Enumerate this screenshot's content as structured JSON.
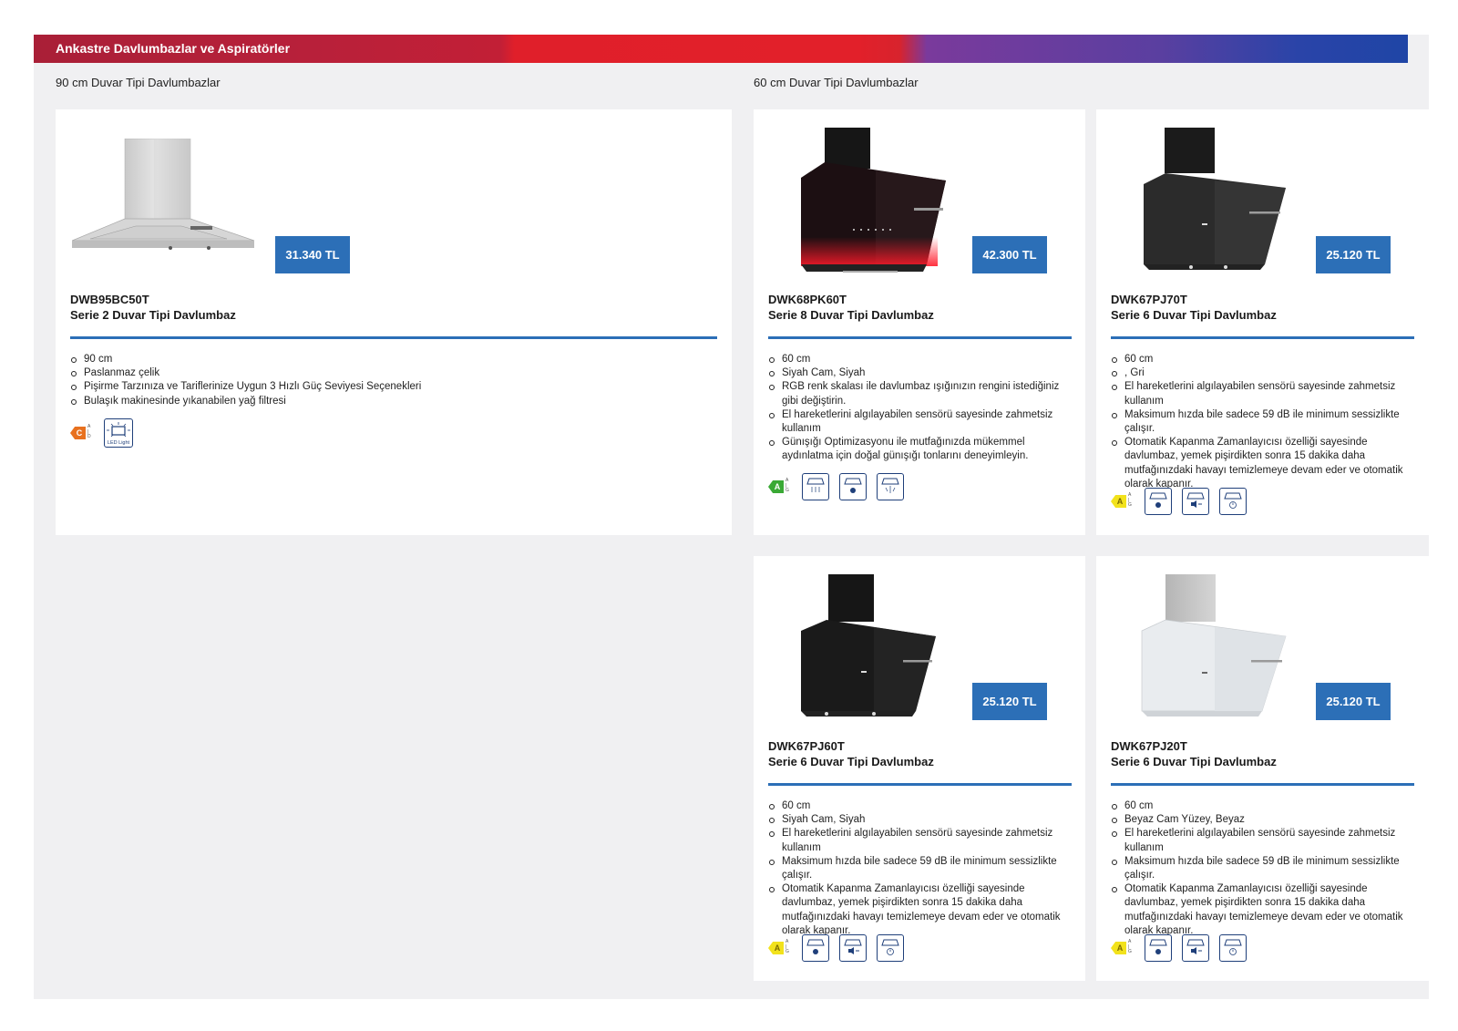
{
  "header": {
    "title": "Ankastre Davlumbazlar ve Aspiratörler"
  },
  "sections": {
    "left": {
      "title": "90 cm Duvar Tipi Davlumbazlar"
    },
    "right": {
      "title": "60 cm Duvar Tipi Davlumbazlar"
    }
  },
  "products": [
    {
      "model": "DWB95BC50T",
      "name": "Serie 2 Duvar Tipi Davlumbaz",
      "price": "31.340 TL",
      "energy_class": "C",
      "energy_color": "#e8711f",
      "features": [
        "90 cm",
        "Paslanmaz çelik",
        "Pişirme Tarzınıza ve Tariflerinize Uygun 3 Hızlı Güç Seviyesi Seçenekleri",
        "Bulaşık makinesinde yıkanabilen yağ filtresi"
      ],
      "icons": [
        "led-light-icon"
      ],
      "icon_label": "LED Light"
    },
    {
      "model": "DWK68PK60T",
      "name": "Serie 8 Duvar Tipi Davlumbaz",
      "price": "42.300 TL",
      "energy_class": "A",
      "energy_color": "#3aa935",
      "features": [
        "60 cm",
        "Siyah Cam, Siyah",
        "RGB renk skalası ile davlumbaz ışığınızın rengini istediğiniz gibi değiştirin.",
        "El hareketlerini algılayabilen sensörü sayesinde zahmetsiz kullanım",
        "Günışığı Optimizasyonu ile mutfağınızda mükemmel aydınlatma için doğal günışığı tonlarını deneyimleyin."
      ],
      "icons": [
        "hood-airflow-icon",
        "hood-sensor-icon",
        "hood-light-icon"
      ]
    },
    {
      "model": "DWK67PJ70T",
      "name": "Serie 6 Duvar Tipi Davlumbaz",
      "price": "25.120 TL",
      "energy_class": "A",
      "energy_color": "#f2e21c",
      "features": [
        "60 cm",
        ", Gri",
        "El hareketlerini algılayabilen sensörü sayesinde zahmetsiz kullanım",
        "Maksimum hızda bile sadece 59 dB ile minimum sessizlikte çalışır.",
        "Otomatik Kapanma Zamanlayıcısı özelliği sayesinde davlumbaz, yemek pişirdikten sonra 15 dakika daha mutfağınızdaki havayı temizlemeye devam eder ve otomatik olarak kapanır."
      ],
      "icons": [
        "hood-sensor-icon",
        "hood-silence-icon",
        "hood-timer-icon"
      ]
    },
    {
      "model": "DWK67PJ60T",
      "name": "Serie 6 Duvar Tipi Davlumbaz",
      "price": "25.120 TL",
      "energy_class": "A",
      "energy_color": "#f2e21c",
      "features": [
        "60 cm",
        "Siyah Cam, Siyah",
        "El hareketlerini algılayabilen sensörü sayesinde zahmetsiz kullanım",
        "Maksimum hızda bile sadece 59 dB ile minimum sessizlikte çalışır.",
        "Otomatik Kapanma Zamanlayıcısı özelliği sayesinde davlumbaz, yemek pişirdikten sonra 15 dakika daha mutfağınızdaki havayı temizlemeye devam eder ve otomatik olarak kapanır."
      ],
      "icons": [
        "hood-sensor-icon",
        "hood-silence-icon",
        "hood-timer-icon"
      ]
    },
    {
      "model": "DWK67PJ20T",
      "name": "Serie 6 Duvar Tipi Davlumbaz",
      "price": "25.120 TL",
      "energy_class": "A",
      "energy_color": "#f2e21c",
      "features": [
        "60 cm",
        "Beyaz Cam Yüzey, Beyaz",
        "El hareketlerini algılayabilen sensörü sayesinde zahmetsiz kullanım",
        "Maksimum hızda bile sadece 59 dB ile minimum sessizlikte çalışır.",
        "Otomatik Kapanma Zamanlayıcısı özelliği sayesinde davlumbaz, yemek pişirdikten sonra 15 dakika daha mutfağınızdaki havayı temizlemeye devam eder ve otomatik olarak kapanır."
      ],
      "icons": [
        "hood-sensor-icon",
        "hood-silence-icon",
        "hood-timer-icon"
      ]
    }
  ]
}
